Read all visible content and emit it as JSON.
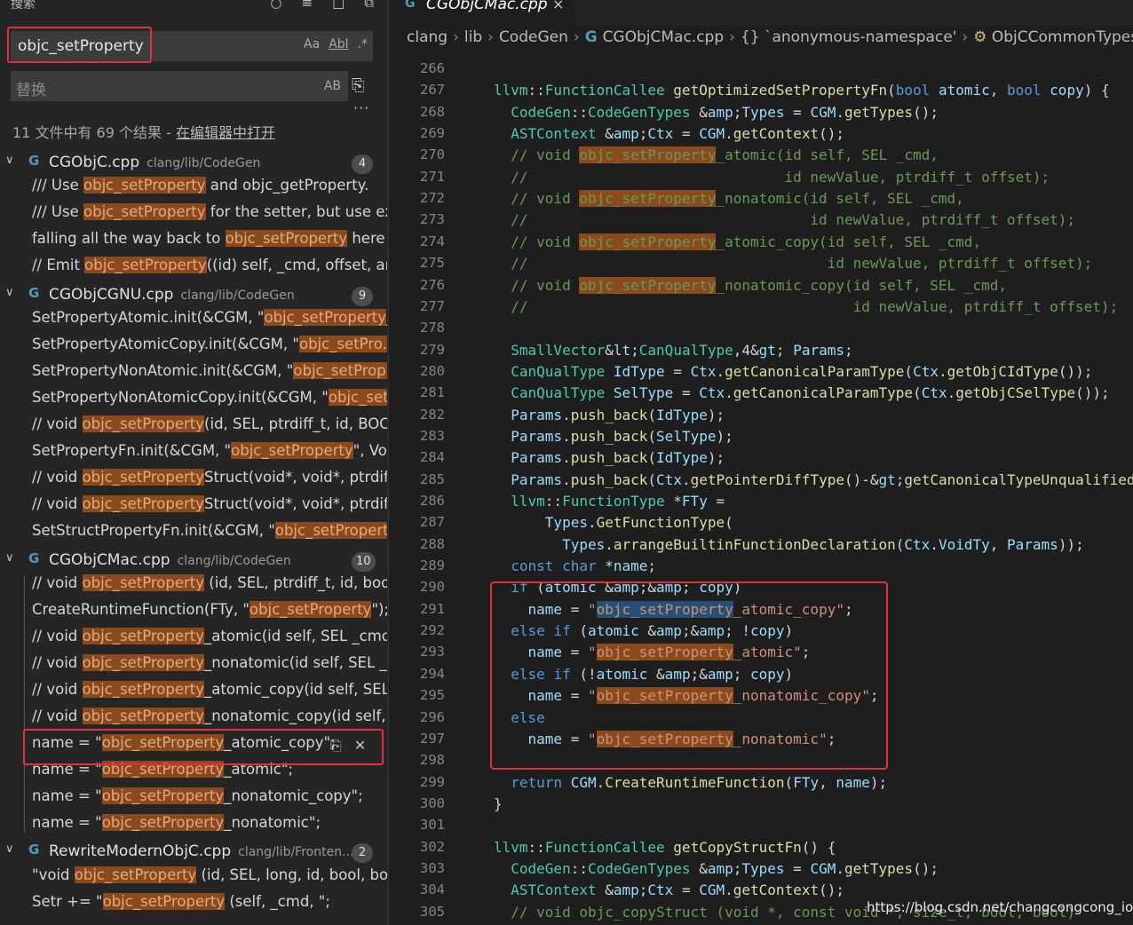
{
  "sidebar": {
    "header": "搜索",
    "tool_icons": [
      "refresh-icon",
      "clear-results-icon",
      "new-search-editor-icon",
      "collapse-all-icon"
    ],
    "search_value": "objc_setProperty",
    "search_options": [
      "Aa",
      "Abl",
      ".*"
    ],
    "replace_placeholder": "替换",
    "replace_option": "AB",
    "summary_prefix": "11 文件中有 69 个结果 - ",
    "summary_link": "在编辑器中打开",
    "files": [
      {
        "name": "CGObjC.cpp",
        "path": "clang/lib/CodeGen",
        "count": "4"
      },
      {
        "name": "CGObjCGNU.cpp",
        "path": "clang/lib/CodeGen",
        "count": "9"
      },
      {
        "name": "CGObjCMac.cpp",
        "path": "clang/lib/CodeGen",
        "count": "10"
      },
      {
        "name": "RewriteModernObjC.cpp",
        "path": "clang/lib/Fronten...",
        "count": "2"
      }
    ],
    "matches": [
      {
        "pre": "/// Use ",
        "m": "objc_setProperty",
        "post": " and objc_getProperty."
      },
      {
        "pre": "/// Use ",
        "m": "objc_setProperty",
        "post": " for the setter, but use ex..."
      },
      {
        "pre": "falling all the way back to ",
        "m": "objc_setProperty",
        "post": " here is"
      },
      {
        "pre": "// Emit ",
        "m": "objc_setProperty",
        "post": "((id) self, _cmd, offset, arg,"
      },
      {
        "pre": "SetPropertyAtomic.init(&CGM, \"",
        "m": "objc_setProperty",
        "post": "_..."
      },
      {
        "pre": "SetPropertyAtomicCopy.init(&CGM, \"",
        "m": "objc_setPro...",
        "post": ""
      },
      {
        "pre": "SetPropertyNonAtomic.init(&CGM, \"",
        "m": "objc_setProp...",
        "post": ""
      },
      {
        "pre": "SetPropertyNonAtomicCopy.init(&CGM, \"",
        "m": "objc_set...",
        "post": ""
      },
      {
        "pre": "// void ",
        "m": "objc_setProperty",
        "post": "(id, SEL, ptrdiff_t, id, BOO..."
      },
      {
        "pre": "SetPropertyFn.init(&CGM, \"",
        "m": "objc_setProperty",
        "post": "\", Voi..."
      },
      {
        "pre": "// void ",
        "m": "objc_setProperty",
        "post": "Struct(void*, void*, ptrdiff_..."
      },
      {
        "pre": "// void ",
        "m": "objc_setProperty",
        "post": "Struct(void*, void*, ptrdiff_..."
      },
      {
        "pre": "SetStructPropertyFn.init(&CGM, \"",
        "m": "objc_setPropert...",
        "post": ""
      },
      {
        "pre": "// void ",
        "m": "objc_setProperty",
        "post": " (id, SEL, ptrdiff_t, id, bool..."
      },
      {
        "pre": "CreateRuntimeFunction(FTy, \"",
        "m": "objc_setProperty",
        "post": "\");"
      },
      {
        "pre": "// void ",
        "m": "objc_setProperty",
        "post": "_atomic(id self, SEL _cmd,"
      },
      {
        "pre": "// void ",
        "m": "objc_setProperty",
        "post": "_nonatomic(id self, SEL _c..."
      },
      {
        "pre": "// void ",
        "m": "objc_setProperty",
        "post": "_atomic_copy(id self, SEL ..."
      },
      {
        "pre": "// void ",
        "m": "objc_setProperty",
        "post": "_nonatomic_copy(id self, ..."
      },
      {
        "pre": "name = \"",
        "m": "objc_setProperty",
        "post": "_atomic_copy\";"
      },
      {
        "pre": "name = \"",
        "m": "objc_setProperty",
        "post": "_atomic\";"
      },
      {
        "pre": "name = \"",
        "m": "objc_setProperty",
        "post": "_nonatomic_copy\";"
      },
      {
        "pre": "name = \"",
        "m": "objc_setProperty",
        "post": "_nonatomic\";"
      },
      {
        "pre": "\"void ",
        "m": "objc_setProperty",
        "post": " (id, SEL, long, id, bool, boo..."
      },
      {
        "pre": "Setr += \"",
        "m": "objc_setProperty",
        "post": " (self, _cmd, \";"
      }
    ]
  },
  "editor": {
    "tab_name": "CGObjCMac.cpp",
    "tab_close": "×",
    "breadcrumbs": [
      "clang",
      "lib",
      "CodeGen",
      "CGObjCMac.cpp",
      "{} `anonymous-namespace'",
      "ObjCCommonTypes"
    ],
    "line_numbers": [
      "266",
      "267",
      "268",
      "269",
      "270",
      "271",
      "272",
      "273",
      "274",
      "275",
      "276",
      "277",
      "278",
      "279",
      "280",
      "281",
      "282",
      "283",
      "284",
      "285",
      "286",
      "287",
      "288",
      "289",
      "290",
      "291",
      "292",
      "293",
      "294",
      "295",
      "296",
      "297",
      "298",
      "299",
      "300",
      "301",
      "302",
      "303",
      "304",
      "305"
    ],
    "lines": [
      "",
      "llvm::FunctionCallee getOptimizedSetPropertyFn(bool atomic, bool copy) {",
      "  CodeGen::CodeGenTypes &Types = CGM.getTypes();",
      "  ASTContext &Ctx = CGM.getContext();",
      "  // void objc_setProperty_atomic(id self, SEL _cmd,",
      "  //                              id newValue, ptrdiff_t offset);",
      "  // void objc_setProperty_nonatomic(id self, SEL _cmd,",
      "  //                                 id newValue, ptrdiff_t offset);",
      "  // void objc_setProperty_atomic_copy(id self, SEL _cmd,",
      "  //                                   id newValue, ptrdiff_t offset);",
      "  // void objc_setProperty_nonatomic_copy(id self, SEL _cmd,",
      "  //                                      id newValue, ptrdiff_t offset);",
      "",
      "  SmallVector<CanQualType,4> Params;",
      "  CanQualType IdType = Ctx.getCanonicalParamType(Ctx.getObjCIdType());",
      "  CanQualType SelType = Ctx.getCanonicalParamType(Ctx.getObjCSelType());",
      "  Params.push_back(IdType);",
      "  Params.push_back(SelType);",
      "  Params.push_back(IdType);",
      "  Params.push_back(Ctx.getPointerDiffType()->getCanonicalTypeUnqualified());",
      "  llvm::FunctionType *FTy =",
      "      Types.GetFunctionType(",
      "        Types.arrangeBuiltinFunctionDeclaration(Ctx.VoidTy, Params));",
      "  const char *name;",
      "  if (atomic && copy)",
      "    name = \"objc_setProperty_atomic_copy\";",
      "  else if (atomic && !copy)",
      "    name = \"objc_setProperty_atomic\";",
      "  else if (!atomic && copy)",
      "    name = \"objc_setProperty_nonatomic_copy\";",
      "  else",
      "    name = \"objc_setProperty_nonatomic\";",
      "",
      "  return CGM.CreateRuntimeFunction(FTy, name);",
      "}",
      "",
      "llvm::FunctionCallee getCopyStructFn() {",
      "  CodeGen::CodeGenTypes &Types = CGM.getTypes();",
      "  ASTContext &Ctx = CGM.getContext();",
      "  // void objc_copyStruct (void *, const void *, size_t, bool, bool)"
    ]
  },
  "watermark": "https://blog.csdn.net/changcongcong_ios",
  "colors": {
    "highlight_box": "#e0303c",
    "match_bg": "#8a4a1e",
    "keyword": "#569cd6",
    "type": "#4ec9b0",
    "function": "#dcdcaa",
    "comment": "#6a9955",
    "string": "#ce9178"
  }
}
